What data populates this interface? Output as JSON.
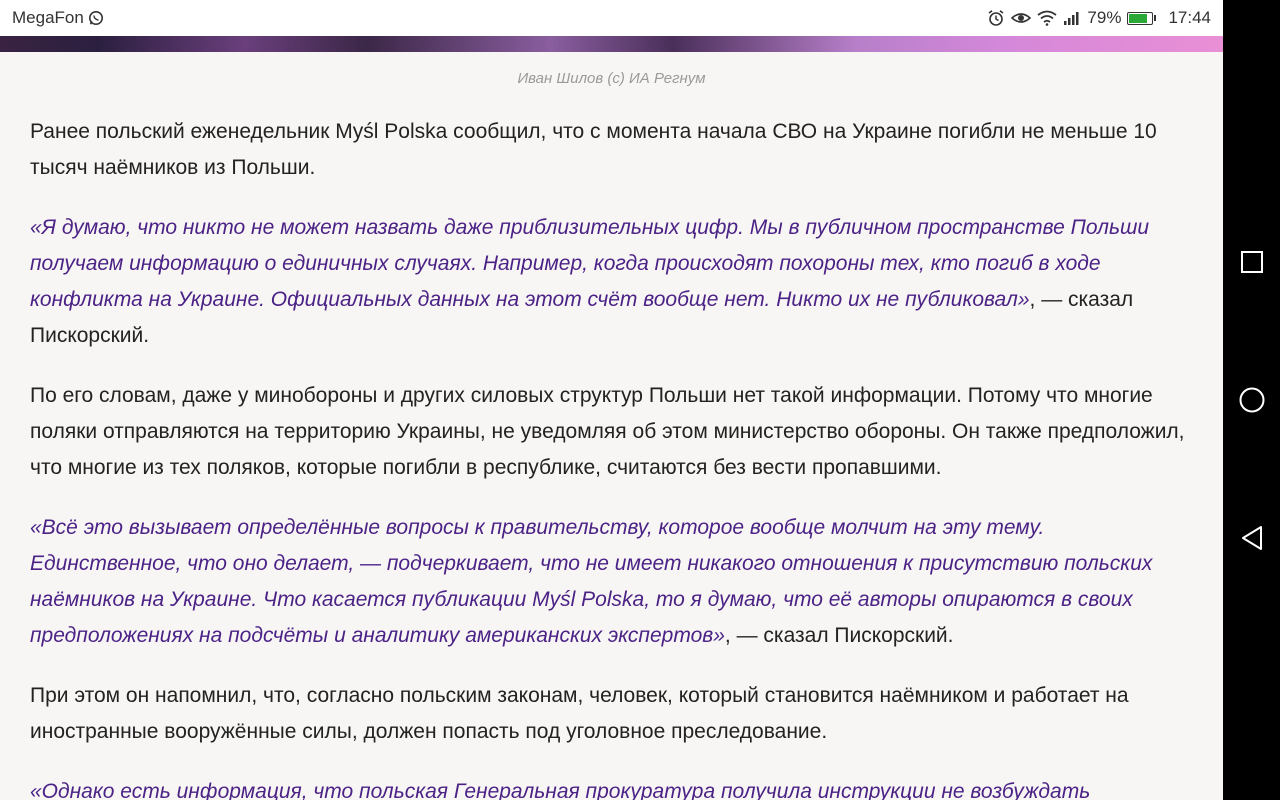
{
  "status_bar": {
    "carrier": "MegaFon",
    "battery_percent": "79%",
    "battery_level": 0.79,
    "time": "17:44",
    "icons": [
      "whatsapp-icon",
      "alarm-icon",
      "eye-comfort-icon",
      "wifi-icon",
      "signal-icon",
      "battery-icon"
    ]
  },
  "article": {
    "image_caption": "Иван Шилов (c) ИА Регнум",
    "paragraphs": [
      {
        "type": "text",
        "text": "Ранее польский еженедельник Myśl Polska сообщил, что с момента начала СВО на Украине погибли не меньше 10 тысяч наёмников из Польши."
      },
      {
        "type": "quote",
        "quote": "«Я думаю, что никто не может назвать даже приблизительных цифр. Мы в публичном пространстве Польши получаем информацию о единичных случаях. Например, когда происходят похороны тех, кто погиб в ходе конфликта на Украине. Официальных данных на этот счёт вообще нет. Никто их не публиковал»",
        "tail": ", — сказал Пискорский."
      },
      {
        "type": "text",
        "text": "По его словам, даже у минобороны и других силовых структур Польши нет такой информации. Потому что многие поляки отправляются на территорию Украины, не уведомляя об этом министерство обороны. Он также предположил, что многие из тех поляков, которые погибли в республике, считаются без вести пропавшими."
      },
      {
        "type": "quote",
        "quote": "«Всё это вызывает определённые вопросы к правительству, которое вообще молчит на эту тему. Единственное, что оно делает, — подчеркивает, что не имеет никакого отношения к присутствию польских наёмников на Украине. Что касается публикации Myśl Polska, то я думаю, что её авторы опираются в своих предположениях на подсчёты и аналитику американских экспертов»",
        "tail": ", — сказал Пискорский."
      },
      {
        "type": "text",
        "text": "При этом он напомнил, что, согласно польским законам, человек, который становится наёмником и работает на иностранные вооружённые силы, должен попасть под уголовное преследование."
      },
      {
        "type": "quote",
        "quote": "«Однако есть информация, что польская Генеральная прокуратура получила инструкции не возбуждать",
        "tail": ""
      }
    ]
  },
  "nav_bar": {
    "buttons": [
      "recents-square-icon",
      "home-circle-icon",
      "back-triangle-icon"
    ]
  },
  "colors": {
    "quote_text": "#4b2286",
    "body_text": "#222222",
    "nav_bar": "#000000",
    "battery_fill": "#2aa838"
  }
}
